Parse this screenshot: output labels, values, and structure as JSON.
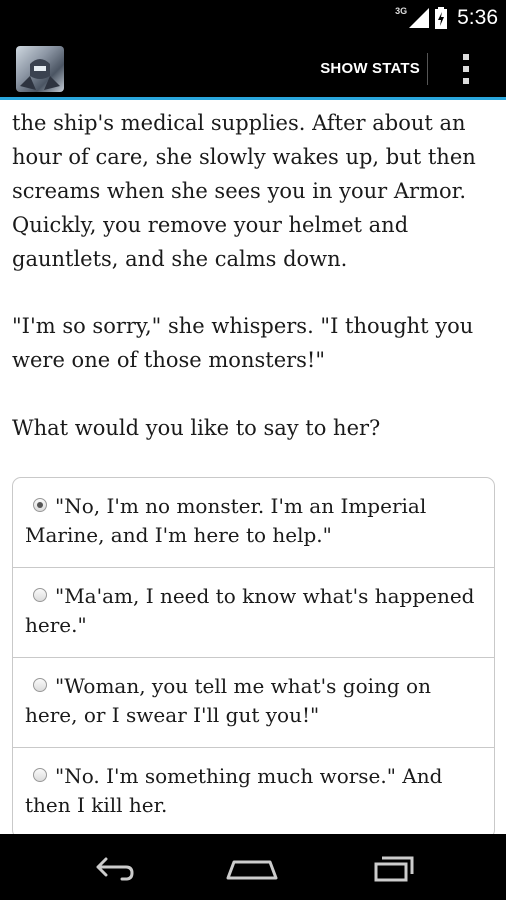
{
  "status_bar": {
    "network_label": "3G",
    "time": "5:36"
  },
  "action_bar": {
    "show_stats_label": "SHOW STATS",
    "overflow_icon": "overflow-menu-icon",
    "accent_color": "#2aa7dd"
  },
  "story": {
    "paragraphs": [
      "the ship's medical supplies. After about an hour of care, she slowly wakes up, but then screams when she sees you in your Armor. Quickly, you remove your helmet and gauntlets, and she calms down.",
      "\"I'm so sorry,\" she whispers. \"I thought you were one of those monsters!\"",
      "What would you like to say to her?"
    ]
  },
  "choices": [
    {
      "text": "\"No, I'm no monster. I'm an Imperial Marine, and I'm here to help.\"",
      "selected": true
    },
    {
      "text": "\"Ma'am, I need to know what's happened here.\"",
      "selected": false
    },
    {
      "text": "\"Woman, you tell me what's going on here, or I swear I'll gut you!\"",
      "selected": false
    },
    {
      "text": "\"No. I'm something much worse.\" And then I kill her.",
      "selected": false
    }
  ],
  "nav_bar": {
    "icons": [
      "back-icon",
      "home-icon",
      "recent-apps-icon"
    ]
  }
}
